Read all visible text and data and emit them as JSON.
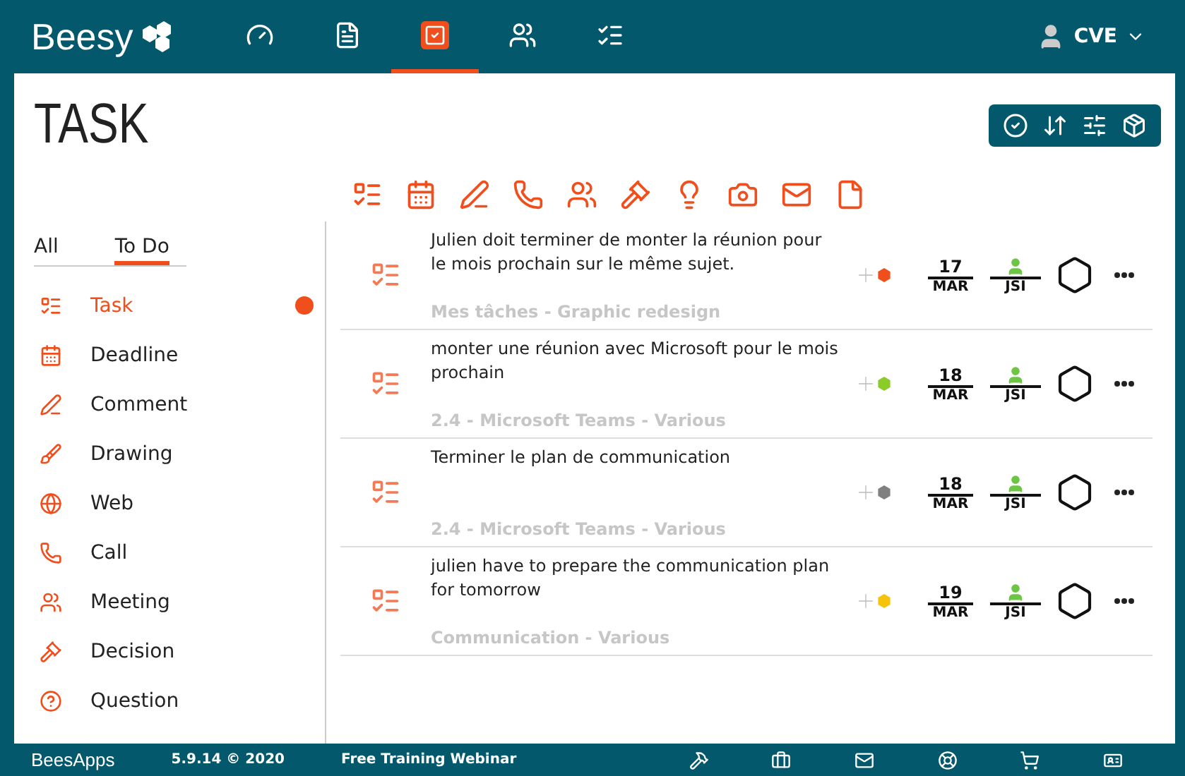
{
  "brand": {
    "logo": "Beesy"
  },
  "nav": [
    {
      "selected": false
    },
    {
      "selected": false
    },
    {
      "selected": true
    },
    {
      "selected": false
    },
    {
      "selected": false
    }
  ],
  "user": {
    "initials": "CVE"
  },
  "page": {
    "title": "TASK"
  },
  "filter_tabs": [
    {
      "label": "All",
      "selected": false
    },
    {
      "label": "To Do",
      "selected": true
    }
  ],
  "sidebar": {
    "items": [
      {
        "label": "Task",
        "selected": true
      },
      {
        "label": "Deadline",
        "selected": false
      },
      {
        "label": "Comment",
        "selected": false
      },
      {
        "label": "Drawing",
        "selected": false
      },
      {
        "label": "Web",
        "selected": false
      },
      {
        "label": "Call",
        "selected": false
      },
      {
        "label": "Meeting",
        "selected": false
      },
      {
        "label": "Decision",
        "selected": false
      },
      {
        "label": "Question",
        "selected": false
      }
    ]
  },
  "tasks": [
    {
      "text": "Julien doit terminer de monter la réunion pour le mois prochain sur le même sujet.",
      "project": "Mes tâches - Graphic redesign",
      "color": "#f04e1c",
      "day": "17",
      "month": "MAR",
      "assignee": "JSI"
    },
    {
      "text": "monter une réunion avec Microsoft pour le mois prochain",
      "project": "2.4 - Microsoft Teams - Various",
      "color": "#8ccc2a",
      "day": "18",
      "month": "MAR",
      "assignee": "JSI"
    },
    {
      "text": "Terminer le plan de communication",
      "project": "2.4 - Microsoft Teams - Various",
      "color": "#808080",
      "day": "18",
      "month": "MAR",
      "assignee": "JSI"
    },
    {
      "text": "julien have to prepare the communication plan for tomorrow",
      "project": "Communication - Various",
      "color": "#f5c20c",
      "day": "19",
      "month": "MAR",
      "assignee": "JSI"
    }
  ],
  "footer": {
    "logo": "BeesApps",
    "version": "5.9.14 © 2020",
    "link": "Free Training Webinar"
  }
}
